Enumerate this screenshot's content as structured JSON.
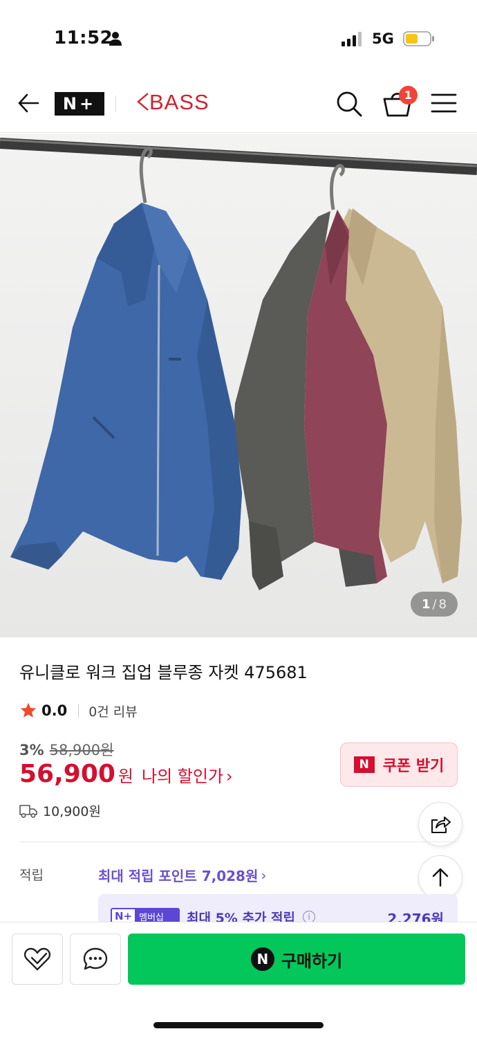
{
  "status_bar": {
    "time": "11:52",
    "network": "5G",
    "icons": [
      "person-icon",
      "signal-icon",
      "battery-icon"
    ]
  },
  "header": {
    "platform_logo": "N+",
    "store_name": "BASS",
    "cart_count": "1",
    "icons": [
      "back-arrow-icon",
      "search-icon",
      "cart-icon",
      "menu-icon"
    ]
  },
  "gallery": {
    "current": "1",
    "separator": "/",
    "total": "8"
  },
  "product": {
    "title": "유니클로 워크 집업 블루종 자켓 475681",
    "rating": "0.0",
    "review_count": "0건 리뷰",
    "discount_rate": "3%",
    "original_price": "58,900원",
    "sale_price": "56,900",
    "price_unit": "원",
    "my_discount_label": "나의 할인가",
    "my_discount_chevron": "›",
    "shipping_fee": "10,900원"
  },
  "coupon": {
    "icon_letter": "N",
    "label": "쿠폰 받기"
  },
  "points": {
    "label": "적립",
    "max_points_label": "최대 적립 포인트 7,028원",
    "chevron": "›",
    "membership_badge_n": "N+",
    "membership_badge_text": "멤버십",
    "membership_text": "최대 5% 추가 적립",
    "membership_info": "i",
    "membership_amount": "2,276원"
  },
  "bottom_bar": {
    "buy_icon_letter": "N",
    "buy_label": "구매하기"
  },
  "colors": {
    "sale_red": "#d50f2f",
    "buy_green": "#03c75a",
    "points_purple": "#6a4fd0",
    "cart_badge": "#f04438",
    "store_logo_red": "#d2202b"
  }
}
